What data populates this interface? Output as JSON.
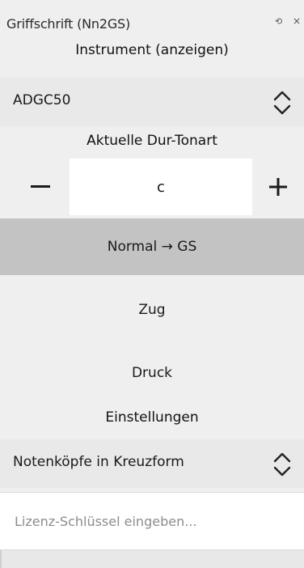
{
  "panel": {
    "title": "Griffschrift (Nn2GS)",
    "float_icon": "float-icon",
    "close_icon": "close-icon"
  },
  "instrument": {
    "heading": "Instrument (anzeigen)",
    "selected": "ADGC50"
  },
  "key": {
    "heading": "Aktuelle Dur-Tonart",
    "value": "c",
    "minus_label": "−",
    "plus_label": "+"
  },
  "modes": [
    {
      "label": "Normal → GS",
      "active": true
    },
    {
      "label": "Zug",
      "active": false
    },
    {
      "label": "Druck",
      "active": false
    }
  ],
  "settings": {
    "heading": "Einstellungen",
    "selected": "Notenköpfe in Kreuzform"
  },
  "license": {
    "placeholder": "Lizenz-Schlüssel eingeben..."
  },
  "colors": {
    "background": "#efefef",
    "select_row": "#e9e9e9",
    "active_button": "#c3c3c3",
    "field": "#ffffff"
  }
}
